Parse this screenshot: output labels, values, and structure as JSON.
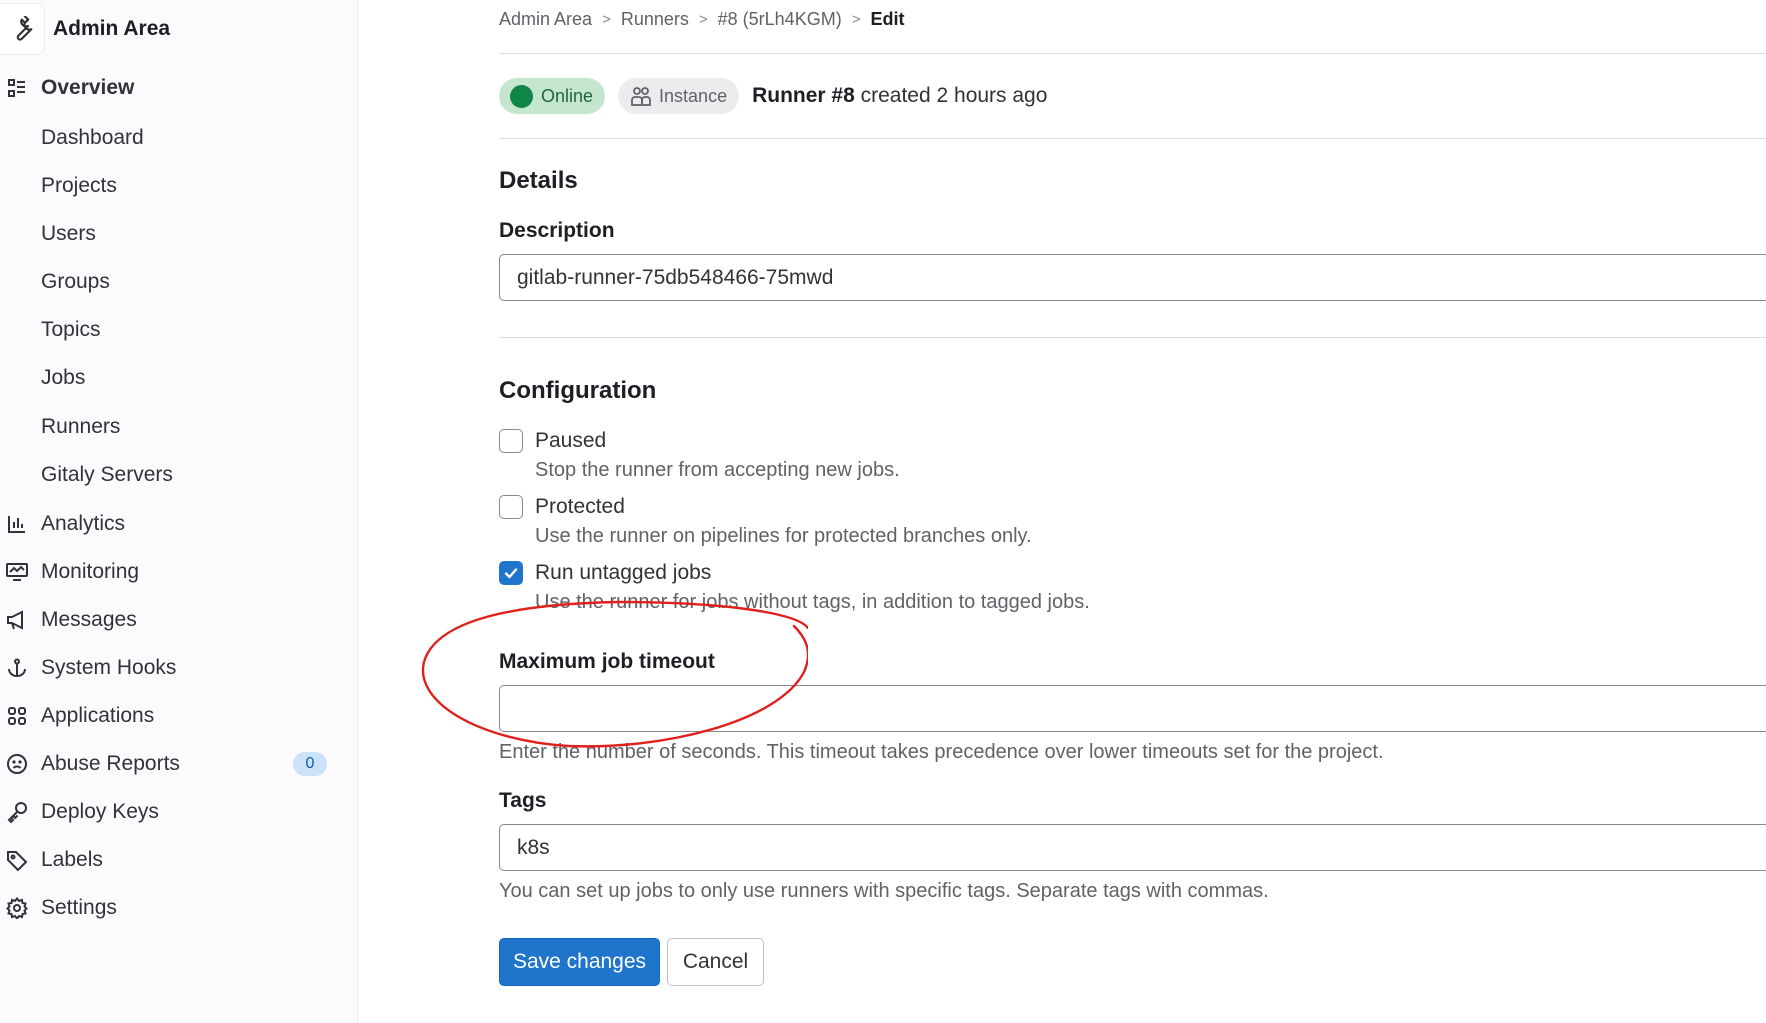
{
  "sidebar": {
    "title": "Admin Area",
    "items": [
      {
        "name": "overview",
        "label": "Overview",
        "icon": "overview-icon"
      },
      {
        "name": "dashboard",
        "label": "Dashboard"
      },
      {
        "name": "projects",
        "label": "Projects"
      },
      {
        "name": "users",
        "label": "Users"
      },
      {
        "name": "groups",
        "label": "Groups"
      },
      {
        "name": "topics",
        "label": "Topics"
      },
      {
        "name": "jobs",
        "label": "Jobs"
      },
      {
        "name": "runners",
        "label": "Runners"
      },
      {
        "name": "gitaly-servers",
        "label": "Gitaly Servers"
      },
      {
        "name": "analytics",
        "label": "Analytics",
        "icon": "chart-icon"
      },
      {
        "name": "monitoring",
        "label": "Monitoring",
        "icon": "monitor-icon"
      },
      {
        "name": "messages",
        "label": "Messages",
        "icon": "bullhorn-icon"
      },
      {
        "name": "system-hooks",
        "label": "System Hooks",
        "icon": "anchor-icon"
      },
      {
        "name": "applications",
        "label": "Applications",
        "icon": "applications-icon"
      },
      {
        "name": "abuse-reports",
        "label": "Abuse Reports",
        "icon": "sad-face-icon",
        "badge": "0"
      },
      {
        "name": "deploy-keys",
        "label": "Deploy Keys",
        "icon": "key-icon"
      },
      {
        "name": "labels",
        "label": "Labels",
        "icon": "label-icon"
      },
      {
        "name": "settings",
        "label": "Settings",
        "icon": "settings-icon"
      }
    ]
  },
  "breadcrumb": [
    "Admin Area",
    "Runners",
    "#8 (5rLh4KGM)",
    "Edit"
  ],
  "status": {
    "online": "Online",
    "instance": "Instance",
    "runner_name": "Runner #8",
    "created": "created 2 hours ago"
  },
  "details": {
    "heading": "Details",
    "description_label": "Description",
    "description_value": "gitlab-runner-75db548466-75mwd"
  },
  "configuration": {
    "heading": "Configuration",
    "paused": {
      "label": "Paused",
      "help": "Stop the runner from accepting new jobs.",
      "checked": false
    },
    "protected": {
      "label": "Protected",
      "help": "Use the runner on pipelines for protected branches only.",
      "checked": false
    },
    "untagged": {
      "label": "Run untagged jobs",
      "help": "Use the runner for jobs without tags, in addition to tagged jobs.",
      "checked": true
    },
    "timeout_label": "Maximum job timeout",
    "timeout_value": "",
    "timeout_help": "Enter the number of seconds. This timeout takes precedence over lower timeouts set for the project.",
    "tags_label": "Tags",
    "tags_value": "k8s",
    "tags_help": "You can set up jobs to only use runners with specific tags. Separate tags with commas."
  },
  "buttons": {
    "save": "Save changes",
    "cancel": "Cancel"
  },
  "colors": {
    "primary": "#1f75cb",
    "online": "#108548",
    "annotation": "#e0201b"
  }
}
